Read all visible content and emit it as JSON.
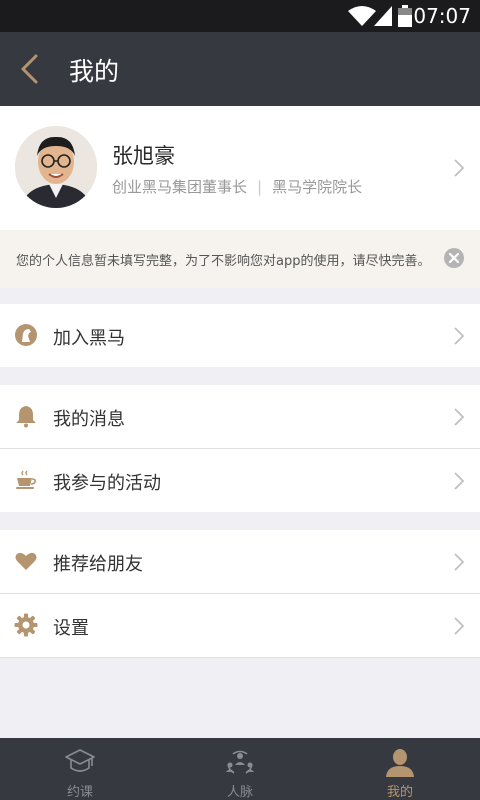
{
  "status_bar": {
    "time": "07:07"
  },
  "header": {
    "title": "我的"
  },
  "profile": {
    "name": "张旭豪",
    "role1": "创业黑马集团董事长",
    "separator": "|",
    "role2": "黑马学院院长"
  },
  "notice": {
    "text": "您的个人信息暂未填写完整，为了不影响您对app的使用，请尽快完善。"
  },
  "menu": {
    "join": "加入黑马",
    "messages": "我的消息",
    "activities": "我参与的活动",
    "recommend": "推荐给朋友",
    "settings": "设置"
  },
  "tabs": [
    {
      "label": "约课",
      "icon": "graduation-cap-icon"
    },
    {
      "label": "人脉",
      "icon": "network-icon"
    },
    {
      "label": "我的",
      "icon": "person-icon"
    }
  ],
  "colors": {
    "header_bg": "#373940",
    "accent": "#b59570",
    "background": "#efeff4"
  }
}
